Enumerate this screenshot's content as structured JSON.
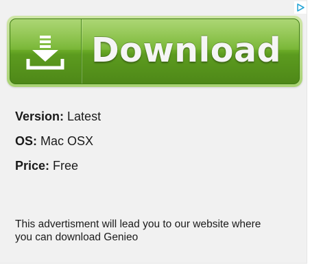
{
  "ad": {
    "adchoices_icon": "adchoices-triangle-icon",
    "button": {
      "icon": "download-arrow-icon",
      "label": "Download",
      "colors": {
        "outer": "#a9d374",
        "top": "#8cc63f",
        "bottom": "#4e8818",
        "text": "#f5f5f5"
      }
    },
    "details": [
      {
        "key": "Version:",
        "value": "Latest"
      },
      {
        "key": "OS:",
        "value": "Mac OSX"
      },
      {
        "key": "Price:",
        "value": "Free"
      }
    ],
    "disclaimer": "This advertisment will lead you to our website where you can download Genieo"
  }
}
